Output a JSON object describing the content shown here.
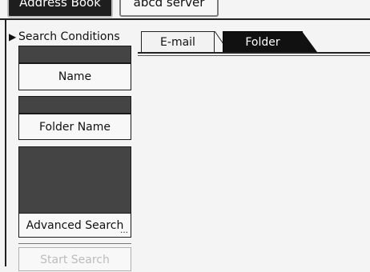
{
  "top_tabs": [
    {
      "label": "Address Book"
    },
    {
      "label": "abcd  server"
    }
  ],
  "search_panel": {
    "title": "Search Conditions",
    "buttons": {
      "name": "Name",
      "folder_name": "Folder Name",
      "advanced_search": "Advanced Search",
      "start_search": "Start Search"
    }
  },
  "tabs": [
    {
      "label": "E-mail",
      "selected": false
    },
    {
      "label": "Folder",
      "selected": true
    }
  ],
  "colors": {
    "dark_tab": "#111111",
    "panel_dark": "#444444",
    "background": "#f4f4f4"
  }
}
